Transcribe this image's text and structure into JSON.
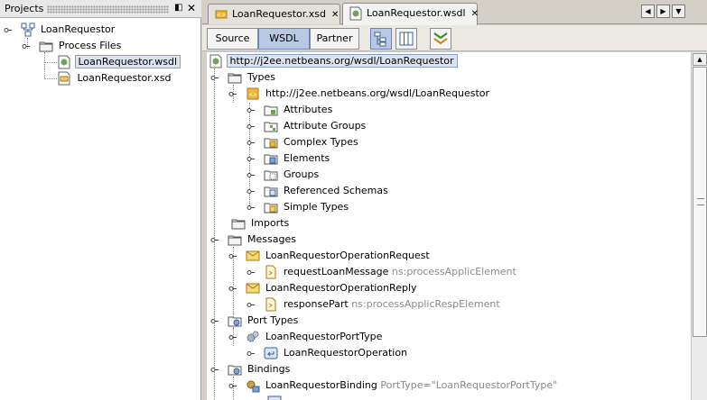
{
  "projects": {
    "title": "Projects",
    "tree": {
      "root": "LoanRequestor",
      "process_files": "Process Files",
      "files": [
        "LoanRequestor.wsdl",
        "LoanRequestor.xsd"
      ]
    }
  },
  "editor": {
    "tabs": [
      {
        "label": "LoanRequestor.xsd"
      },
      {
        "label": "LoanRequestor.wsdl"
      }
    ],
    "views": {
      "source": "Source",
      "wsdl": "WSDL",
      "partner": "Partner"
    },
    "tree": {
      "root": "http://j2ee.netbeans.org/wsdl/LoanRequestor",
      "types": "Types",
      "schema": "http://j2ee.netbeans.org/wsdl/LoanRequestor",
      "schema_children": [
        "Attributes",
        "Attribute Groups",
        "Complex Types",
        "Elements",
        "Groups",
        "Referenced Schemas",
        "Simple Types"
      ],
      "imports": "Imports",
      "messages": "Messages",
      "request_message": "LoanRequestorOperationRequest",
      "request_part": "requestLoanMessage",
      "request_part_type": "ns:processApplicElement",
      "reply_message": "LoanRequestorOperationReply",
      "reply_part": "responsePart",
      "reply_part_type": "ns:processApplicRespElement",
      "port_types": "Port Types",
      "port_type": "LoanRequestorPortType",
      "operation": "LoanRequestorOperation",
      "bindings": "Bindings",
      "binding": "LoanRequestorBinding",
      "binding_attr": "PortType=\"LoanRequestorPortType\""
    }
  },
  "colors": {
    "selection": "#dce3ef",
    "toggle_on": "#b9c9e4",
    "hint": "#8a8a8a"
  }
}
